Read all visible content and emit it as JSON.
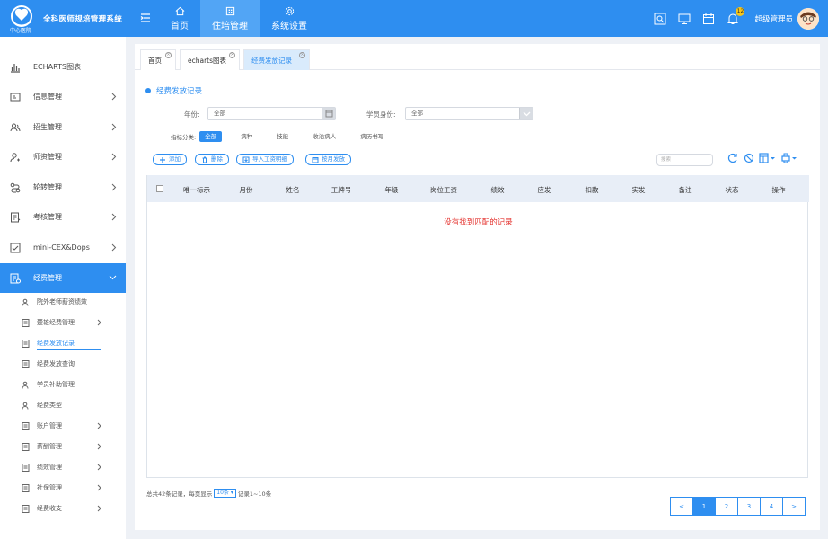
{
  "app": {
    "title": "全科医师规培管理系统",
    "subtitle": "中心医院"
  },
  "topnav": {
    "items": [
      {
        "label": "首页",
        "icon": "home-icon"
      },
      {
        "label": "住培管理",
        "icon": "building-icon",
        "active": true
      },
      {
        "label": "系统设置",
        "icon": "gear-icon"
      }
    ]
  },
  "header": {
    "notification_count": "12",
    "user_name": "超级管理员"
  },
  "sidebar": {
    "items": [
      {
        "label": "ECHARTS图表",
        "icon": "chart-icon"
      },
      {
        "label": "信息管理",
        "icon": "info-icon"
      },
      {
        "label": "招生管理",
        "icon": "people-icon"
      },
      {
        "label": "师资管理",
        "icon": "teacher-icon"
      },
      {
        "label": "轮转管理",
        "icon": "rotate-icon"
      },
      {
        "label": "考核管理",
        "icon": "exam-icon"
      },
      {
        "label": "mini-CEX&Dops",
        "icon": "minicex-icon"
      },
      {
        "label": "经费管理",
        "icon": "fund-icon",
        "active": true
      }
    ],
    "subitems": [
      {
        "label": "院外老师薪资绩效",
        "icon": "user-icon"
      },
      {
        "label": "楚雄经费管理",
        "icon": "doc-icon",
        "has_arrow": true
      },
      {
        "label": "经费发放记录",
        "icon": "doc-icon",
        "active": true
      },
      {
        "label": "经费发放查询",
        "icon": "doc-icon"
      },
      {
        "label": "学员补助管理",
        "icon": "user-icon"
      },
      {
        "label": "经费类型",
        "icon": "user-icon"
      },
      {
        "label": "账户管理",
        "icon": "doc-icon",
        "has_arrow": true
      },
      {
        "label": "薪酬管理",
        "icon": "doc-icon",
        "has_arrow": true
      },
      {
        "label": "绩效管理",
        "icon": "doc-icon",
        "has_arrow": true
      },
      {
        "label": "社保管理",
        "icon": "doc-icon",
        "has_arrow": true
      },
      {
        "label": "经费收支",
        "icon": "doc-icon",
        "has_arrow": true
      }
    ]
  },
  "tabs": [
    {
      "label": "首页"
    },
    {
      "label": "echarts图表"
    },
    {
      "label": "经费发放记录",
      "active": true
    }
  ],
  "page": {
    "title": "经费发放记录",
    "filters": {
      "year_label": "年份:",
      "year_value": "全部",
      "identity_label": "学员身份:",
      "identity_value": "全部"
    },
    "category_label": "指标分类:",
    "categories": [
      "全部",
      "病种",
      "技能",
      "收治病人",
      "病历书写"
    ],
    "toolbar": {
      "add": "添加",
      "delete": "删除",
      "import": "导入工资明细",
      "monthly": "按月发放",
      "search_placeholder": "搜索"
    },
    "table": {
      "columns": [
        "唯一标示",
        "月份",
        "姓名",
        "工牌号",
        "年级",
        "岗位工资",
        "绩效",
        "应发",
        "扣款",
        "实发",
        "备注",
        "状态",
        "操作"
      ],
      "empty_text": "没有找到匹配的记录"
    },
    "footer": {
      "total_text": "总共42条记录，每页显示",
      "page_size": "10条",
      "range_text": "记录1~10条"
    },
    "pagination": {
      "prev": "<",
      "pages": [
        "1",
        "2",
        "3",
        "4"
      ],
      "next": ">"
    }
  },
  "colors": {
    "primary": "#2e8ef0",
    "error": "#e53935"
  }
}
